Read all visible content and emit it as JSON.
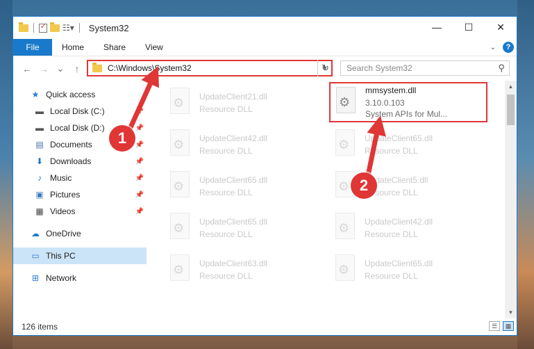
{
  "window": {
    "title": "System32",
    "controls": {
      "minimize": "—",
      "maximize": "☐",
      "close": "✕"
    }
  },
  "ribbon": {
    "tabs": [
      "File",
      "Home",
      "Share",
      "View"
    ]
  },
  "navigation": {
    "back": "←",
    "forward": "→",
    "recent": "⌄",
    "up": "↑",
    "address": "C:\\Windows\\System32",
    "refresh": "↻",
    "search_placeholder": "Search System32"
  },
  "sidebar": {
    "items": [
      {
        "label": "Quick access",
        "icon": "star-icon"
      },
      {
        "label": "Local Disk (C:)",
        "icon": "drive-icon",
        "pinned": true
      },
      {
        "label": "Local Disk (D:)",
        "icon": "drive-icon",
        "pinned": true
      },
      {
        "label": "Documents",
        "icon": "documents-icon",
        "pinned": true
      },
      {
        "label": "Downloads",
        "icon": "download-icon",
        "pinned": true
      },
      {
        "label": "Music",
        "icon": "music-icon",
        "pinned": true
      },
      {
        "label": "Pictures",
        "icon": "pictures-icon",
        "pinned": true
      },
      {
        "label": "Videos",
        "icon": "videos-icon",
        "pinned": true
      },
      {
        "label": "OneDrive",
        "icon": "cloud-icon"
      },
      {
        "label": "This PC",
        "icon": "pc-icon",
        "selected": true
      },
      {
        "label": "Network",
        "icon": "network-icon"
      }
    ]
  },
  "files": [
    {
      "name": "UpdateClient21.dll",
      "desc": "Resource DLL"
    },
    {
      "name": "mmsystem.dll",
      "version": "3.10.0.103",
      "desc": "System APIs for Mul..."
    },
    {
      "name": "UpdateClient42.dll",
      "desc": "Resource DLL"
    },
    {
      "name": "UpdateClient65.dll",
      "desc": "Resource DLL"
    },
    {
      "name": "UpdateClient65.dll",
      "desc": "Resource DLL"
    },
    {
      "name": "UpdateClient5.dll",
      "desc": "Resource DLL"
    },
    {
      "name": "UpdateClient65.dll",
      "desc": "Resource DLL"
    },
    {
      "name": "UpdateClient42.dll",
      "desc": "Resource DLL"
    },
    {
      "name": "UpdateClient63.dll",
      "desc": "Resource DLL"
    },
    {
      "name": "UpdateClient65.dll",
      "desc": "Resource DLL"
    }
  ],
  "status": {
    "item_count": "126 items"
  },
  "annotations": {
    "badge1": "1",
    "badge2": "2"
  },
  "colors": {
    "accent": "#1979ca",
    "highlight": "#e03636",
    "selected_bg": "#cce4f7"
  }
}
